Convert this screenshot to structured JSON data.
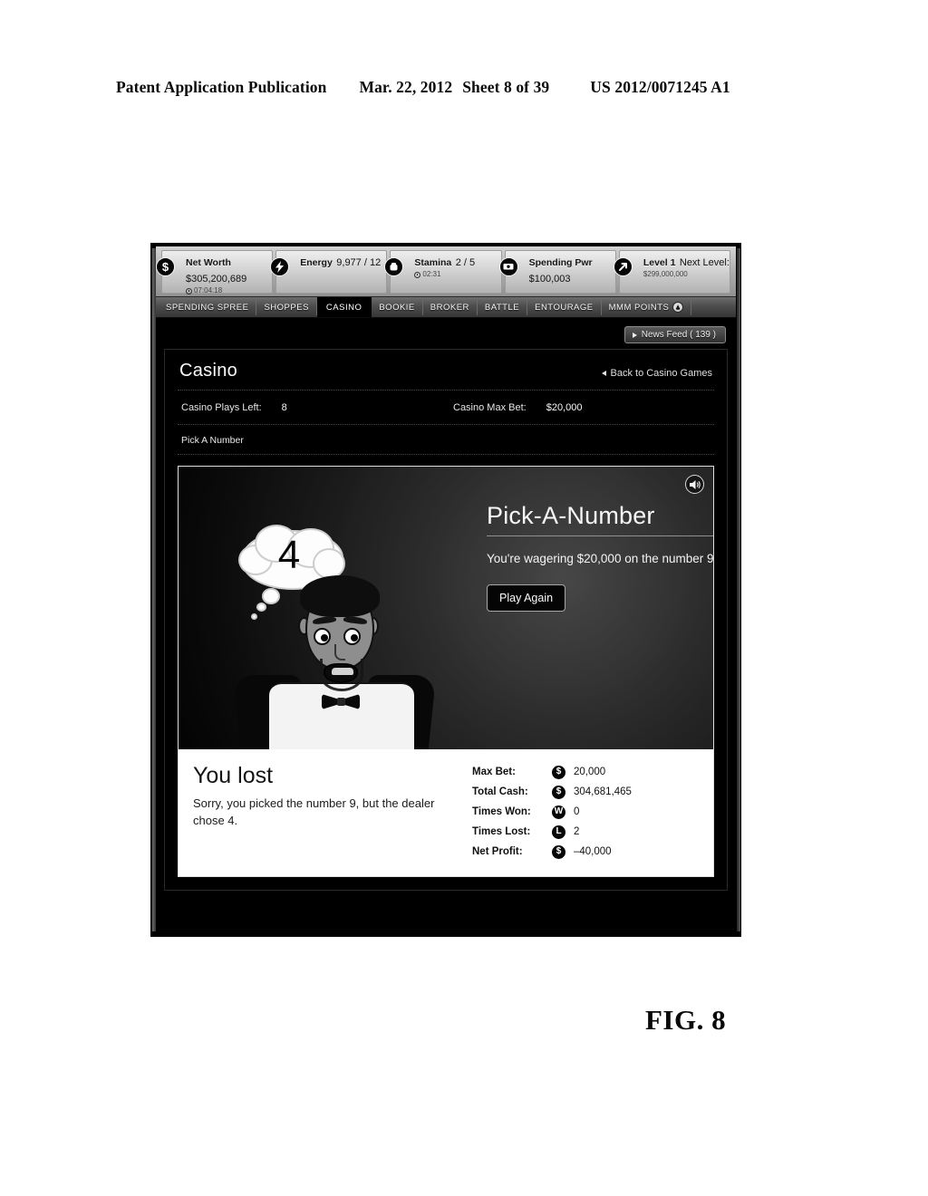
{
  "patent": {
    "publication": "Patent Application Publication",
    "date": "Mar. 22, 2012",
    "sheet": "Sheet 8 of 39",
    "number": "US 2012/0071245 A1",
    "figure": "FIG. 8"
  },
  "stats_bar": [
    {
      "icon": "dollar-icon",
      "label": "Net Worth",
      "value": "$305,200,689",
      "sub": "07:04:18"
    },
    {
      "icon": "lightning-icon",
      "label": "Energy",
      "value": "9,977 / 12",
      "sub": ""
    },
    {
      "icon": "fist-icon",
      "label": "Stamina",
      "value": "2 / 5",
      "sub": "02:31"
    },
    {
      "icon": "money-stack-icon",
      "label": "Spending Pwr",
      "value": "$100,003",
      "sub": ""
    },
    {
      "icon": "arrow-up-icon",
      "label": "Level 1",
      "value": "Next Level:",
      "sub": "$299,000,000"
    }
  ],
  "nav_tabs": [
    {
      "label": "SPENDING SPREE",
      "active": false
    },
    {
      "label": "SHOPPES",
      "active": false
    },
    {
      "label": "CASINO",
      "active": true
    },
    {
      "label": "BOOKIE",
      "active": false
    },
    {
      "label": "BROKER",
      "active": false
    },
    {
      "label": "BATTLE",
      "active": false
    },
    {
      "label": "ENTOURAGE",
      "active": false
    },
    {
      "label": "MMM POINTS",
      "active": false
    }
  ],
  "news_feed": {
    "label": "News Feed ( 139 )"
  },
  "panel": {
    "title": "Casino",
    "back_link": "Back to Casino Games",
    "plays_left_label": "Casino Plays Left:",
    "plays_left_value": "8",
    "max_bet_label": "Casino Max Bet:",
    "max_bet_value": "$20,000",
    "section_label": "Pick A Number"
  },
  "game": {
    "title": "Pick-A-Number",
    "wager_text": "You're wagering $20,000 on the number 9.",
    "play_again": "Play Again",
    "dealer_number": "4",
    "sound_icon": "speaker-icon"
  },
  "result": {
    "heading": "You lost",
    "body": "Sorry, you picked the number 9, but the dealer chose 4.",
    "stats": [
      {
        "label": "Max Bet:",
        "icon": "dollar-icon",
        "value": "20,000"
      },
      {
        "label": "Total Cash:",
        "icon": "dollar-icon",
        "value": "304,681,465"
      },
      {
        "label": "Times Won:",
        "icon": "won-icon",
        "value": "0"
      },
      {
        "label": "Times Lost:",
        "icon": "lost-icon",
        "value": "2"
      },
      {
        "label": "Net Profit:",
        "icon": "dollar-icon",
        "value": "–40,000"
      }
    ]
  }
}
